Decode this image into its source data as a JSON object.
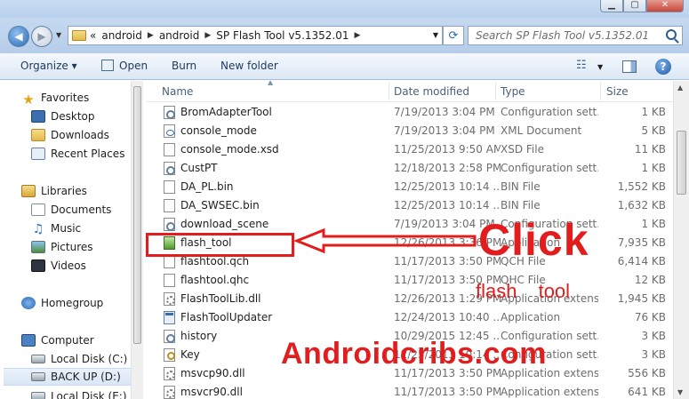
{
  "address": {
    "crumbs": [
      "«",
      "android",
      "android",
      "SP Flash Tool v5.1352.01"
    ]
  },
  "search": {
    "placeholder": "Search SP Flash Tool v5.1352.01"
  },
  "toolbar": {
    "organize": "Organize ▾",
    "open": "Open",
    "burn": "Burn",
    "new_folder": "New folder"
  },
  "navpane": {
    "favorites": "Favorites",
    "desktop": "Desktop",
    "downloads": "Downloads",
    "recent": "Recent Places",
    "libraries": "Libraries",
    "documents": "Documents",
    "music": "Music",
    "pictures": "Pictures",
    "videos": "Videos",
    "homegroup": "Homegroup",
    "computer": "Computer",
    "local_c": "Local Disk (C:)",
    "backup_d": "BACK UP (D:)",
    "local_e": "Local Disk (E:)"
  },
  "columns": {
    "name": "Name",
    "date": "Date modified",
    "type": "Type",
    "size": "Size"
  },
  "files": [
    {
      "name": "BromAdapterTool",
      "date": "7/19/2013 3:04 PM",
      "type": "Configuration sett...",
      "size": "1 KB",
      "icon": "cfg"
    },
    {
      "name": "console_mode",
      "date": "7/19/2013 3:04 PM",
      "type": "XML Document",
      "size": "5 KB",
      "icon": "xml"
    },
    {
      "name": "console_mode.xsd",
      "date": "11/25/2013 9:50 AM",
      "type": "XSD File",
      "size": "11 KB",
      "icon": "doc"
    },
    {
      "name": "CustPT",
      "date": "12/18/2013 2:58 PM",
      "type": "Configuration sett...",
      "size": "1 KB",
      "icon": "cfg"
    },
    {
      "name": "DA_PL.bin",
      "date": "12/25/2013 10:14 ...",
      "type": "BIN File",
      "size": "1,552 KB",
      "icon": "doc"
    },
    {
      "name": "DA_SWSEC.bin",
      "date": "12/25/2013 10:14 ...",
      "type": "BIN File",
      "size": "1,632 KB",
      "icon": "doc"
    },
    {
      "name": "download_scene",
      "date": "7/19/2013 3:04 PM",
      "type": "Configuration sett...",
      "size": "1 KB",
      "icon": "cfg"
    },
    {
      "name": "flash_tool",
      "date": "12/26/2013 3:36 PM",
      "type": "Application",
      "size": "7,935 KB",
      "icon": "exe"
    },
    {
      "name": "flashtool.qch",
      "date": "11/17/2013 3:50 PM",
      "type": "QCH File",
      "size": "6,414 KB",
      "icon": "doc"
    },
    {
      "name": "flashtool.qhc",
      "date": "11/17/2013 3:50 PM",
      "type": "QHC File",
      "size": "12 KB",
      "icon": "doc"
    },
    {
      "name": "FlashToolLib.dll",
      "date": "12/26/2013 1:29 PM",
      "type": "Application extens...",
      "size": "1,945 KB",
      "icon": "dll"
    },
    {
      "name": "FlashToolUpdater",
      "date": "12/24/2013 10:40 ...",
      "type": "Application",
      "size": "76 KB",
      "icon": "app"
    },
    {
      "name": "history",
      "date": "10/29/2015 12:45 ...",
      "type": "Configuration sett...",
      "size": "3 KB",
      "icon": "cfg"
    },
    {
      "name": "Key",
      "date": "12/25/2013 10:14 ...",
      "type": "Configuration sett...",
      "size": "3 KB",
      "icon": "key"
    },
    {
      "name": "msvcp90.dll",
      "date": "11/17/2013 3:50 PM",
      "type": "Application extens...",
      "size": "556 KB",
      "icon": "dll"
    },
    {
      "name": "msvcr90.dll",
      "date": "11/17/2013 3:50 PM",
      "type": "Application extens...",
      "size": "641 KB",
      "icon": "dll"
    }
  ],
  "annotation": {
    "click": "Click",
    "target": "flash tool",
    "site": "Androidcribs.com",
    "color": "#e31d1d"
  }
}
